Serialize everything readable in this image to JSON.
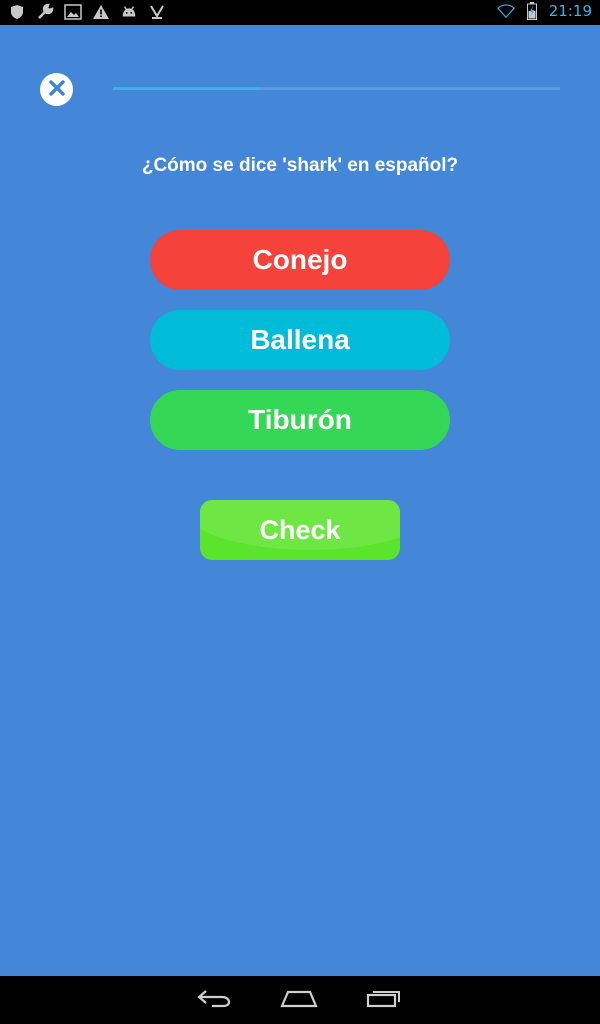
{
  "status_bar": {
    "time": "21:19",
    "icons": [
      "shield-icon",
      "wrench-icon",
      "image-icon",
      "warning-icon",
      "android-icon",
      "download-icon",
      "wifi-icon",
      "battery-icon"
    ]
  },
  "quiz": {
    "progress": 0.33,
    "question": "¿Cómo se dice 'shark' en español?",
    "options": [
      {
        "label": "Conejo",
        "color": "#f5433b"
      },
      {
        "label": "Ballena",
        "color": "#00bcd9"
      },
      {
        "label": "Tiburón",
        "color": "#35d756"
      }
    ],
    "check_label": "Check",
    "check_color": "#5ae42c"
  },
  "colors": {
    "background": "#4487d9",
    "progress_fill": "#3db0e8",
    "progress_track": "#5a9ae6"
  },
  "nav_bar": {
    "icons": [
      "back-icon",
      "home-icon",
      "recent-apps-icon"
    ]
  }
}
